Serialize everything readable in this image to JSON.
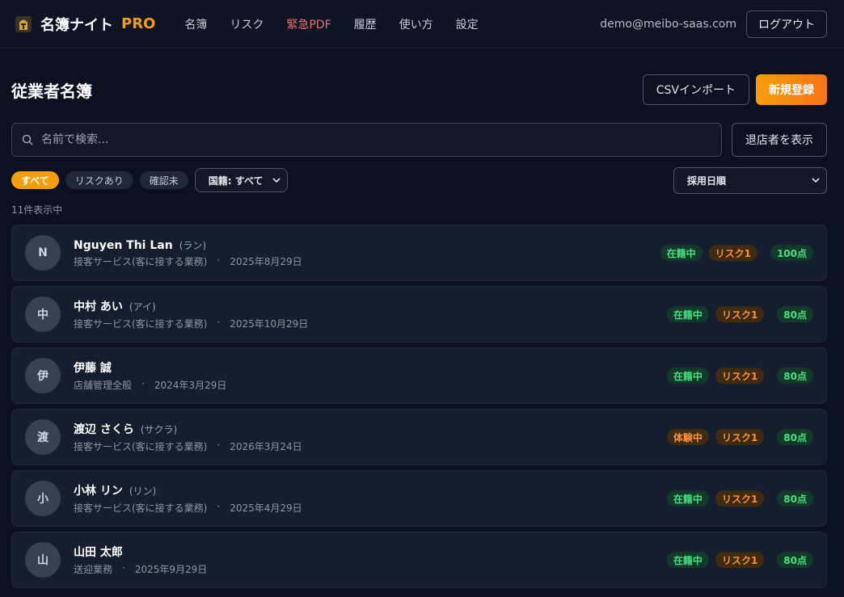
{
  "nav": {
    "brand": "名簿ナイト",
    "brand_suffix": "PRO",
    "items": [
      "名簿",
      "リスク",
      "緊急PDF",
      "履歴",
      "使い方",
      "設定"
    ],
    "user_email": "demo@meibo-saas.com",
    "logout_label": "ログアウト"
  },
  "header": {
    "title": "従業者名簿",
    "csv_label": "CSVインポート",
    "new_label": "新規登録"
  },
  "search": {
    "placeholder": "名前で検索...",
    "retired_label": "退店者を表示"
  },
  "filters": {
    "chips": [
      "すべて",
      "リスクあり",
      "確認未"
    ],
    "nationality": "国籍: すべて",
    "sort": "採用日順"
  },
  "count_text": "11件表示中",
  "colors": {
    "accent": "#f59e0b",
    "danger": "#f07070",
    "ok": "#4ade80",
    "warn": "#fb923c"
  },
  "employees": [
    {
      "initial": "N",
      "name": "Nguyen Thi Lan",
      "kana": "(ラン)",
      "role": "接客サービス(客に接する業務)",
      "date": "2025年8月29日",
      "status": "在籍中",
      "risk": "リスク1",
      "score": "100点"
    },
    {
      "initial": "中",
      "name": "中村 あい",
      "kana": "(アイ)",
      "role": "接客サービス(客に接する業務)",
      "date": "2025年10月29日",
      "status": "在籍中",
      "risk": "リスク1",
      "score": "80点"
    },
    {
      "initial": "伊",
      "name": "伊藤 誠",
      "kana": "",
      "role": "店舗管理全般",
      "date": "2024年3月29日",
      "status": "在籍中",
      "risk": "リスク1",
      "score": "80点"
    },
    {
      "initial": "渡",
      "name": "渡辺 さくら",
      "kana": "(サクラ)",
      "role": "接客サービス(客に接する業務)",
      "date": "2026年3月24日",
      "status": "体験中",
      "risk": "リスク1",
      "score": "80点"
    },
    {
      "initial": "小",
      "name": "小林 リン",
      "kana": "(リン)",
      "role": "接客サービス(客に接する業務)",
      "date": "2025年4月29日",
      "status": "在籍中",
      "risk": "リスク1",
      "score": "80点"
    },
    {
      "initial": "山",
      "name": "山田 太郎",
      "kana": "",
      "role": "送迎業務",
      "date": "2025年9月29日",
      "status": "在籍中",
      "risk": "リスク1",
      "score": "80点"
    }
  ]
}
